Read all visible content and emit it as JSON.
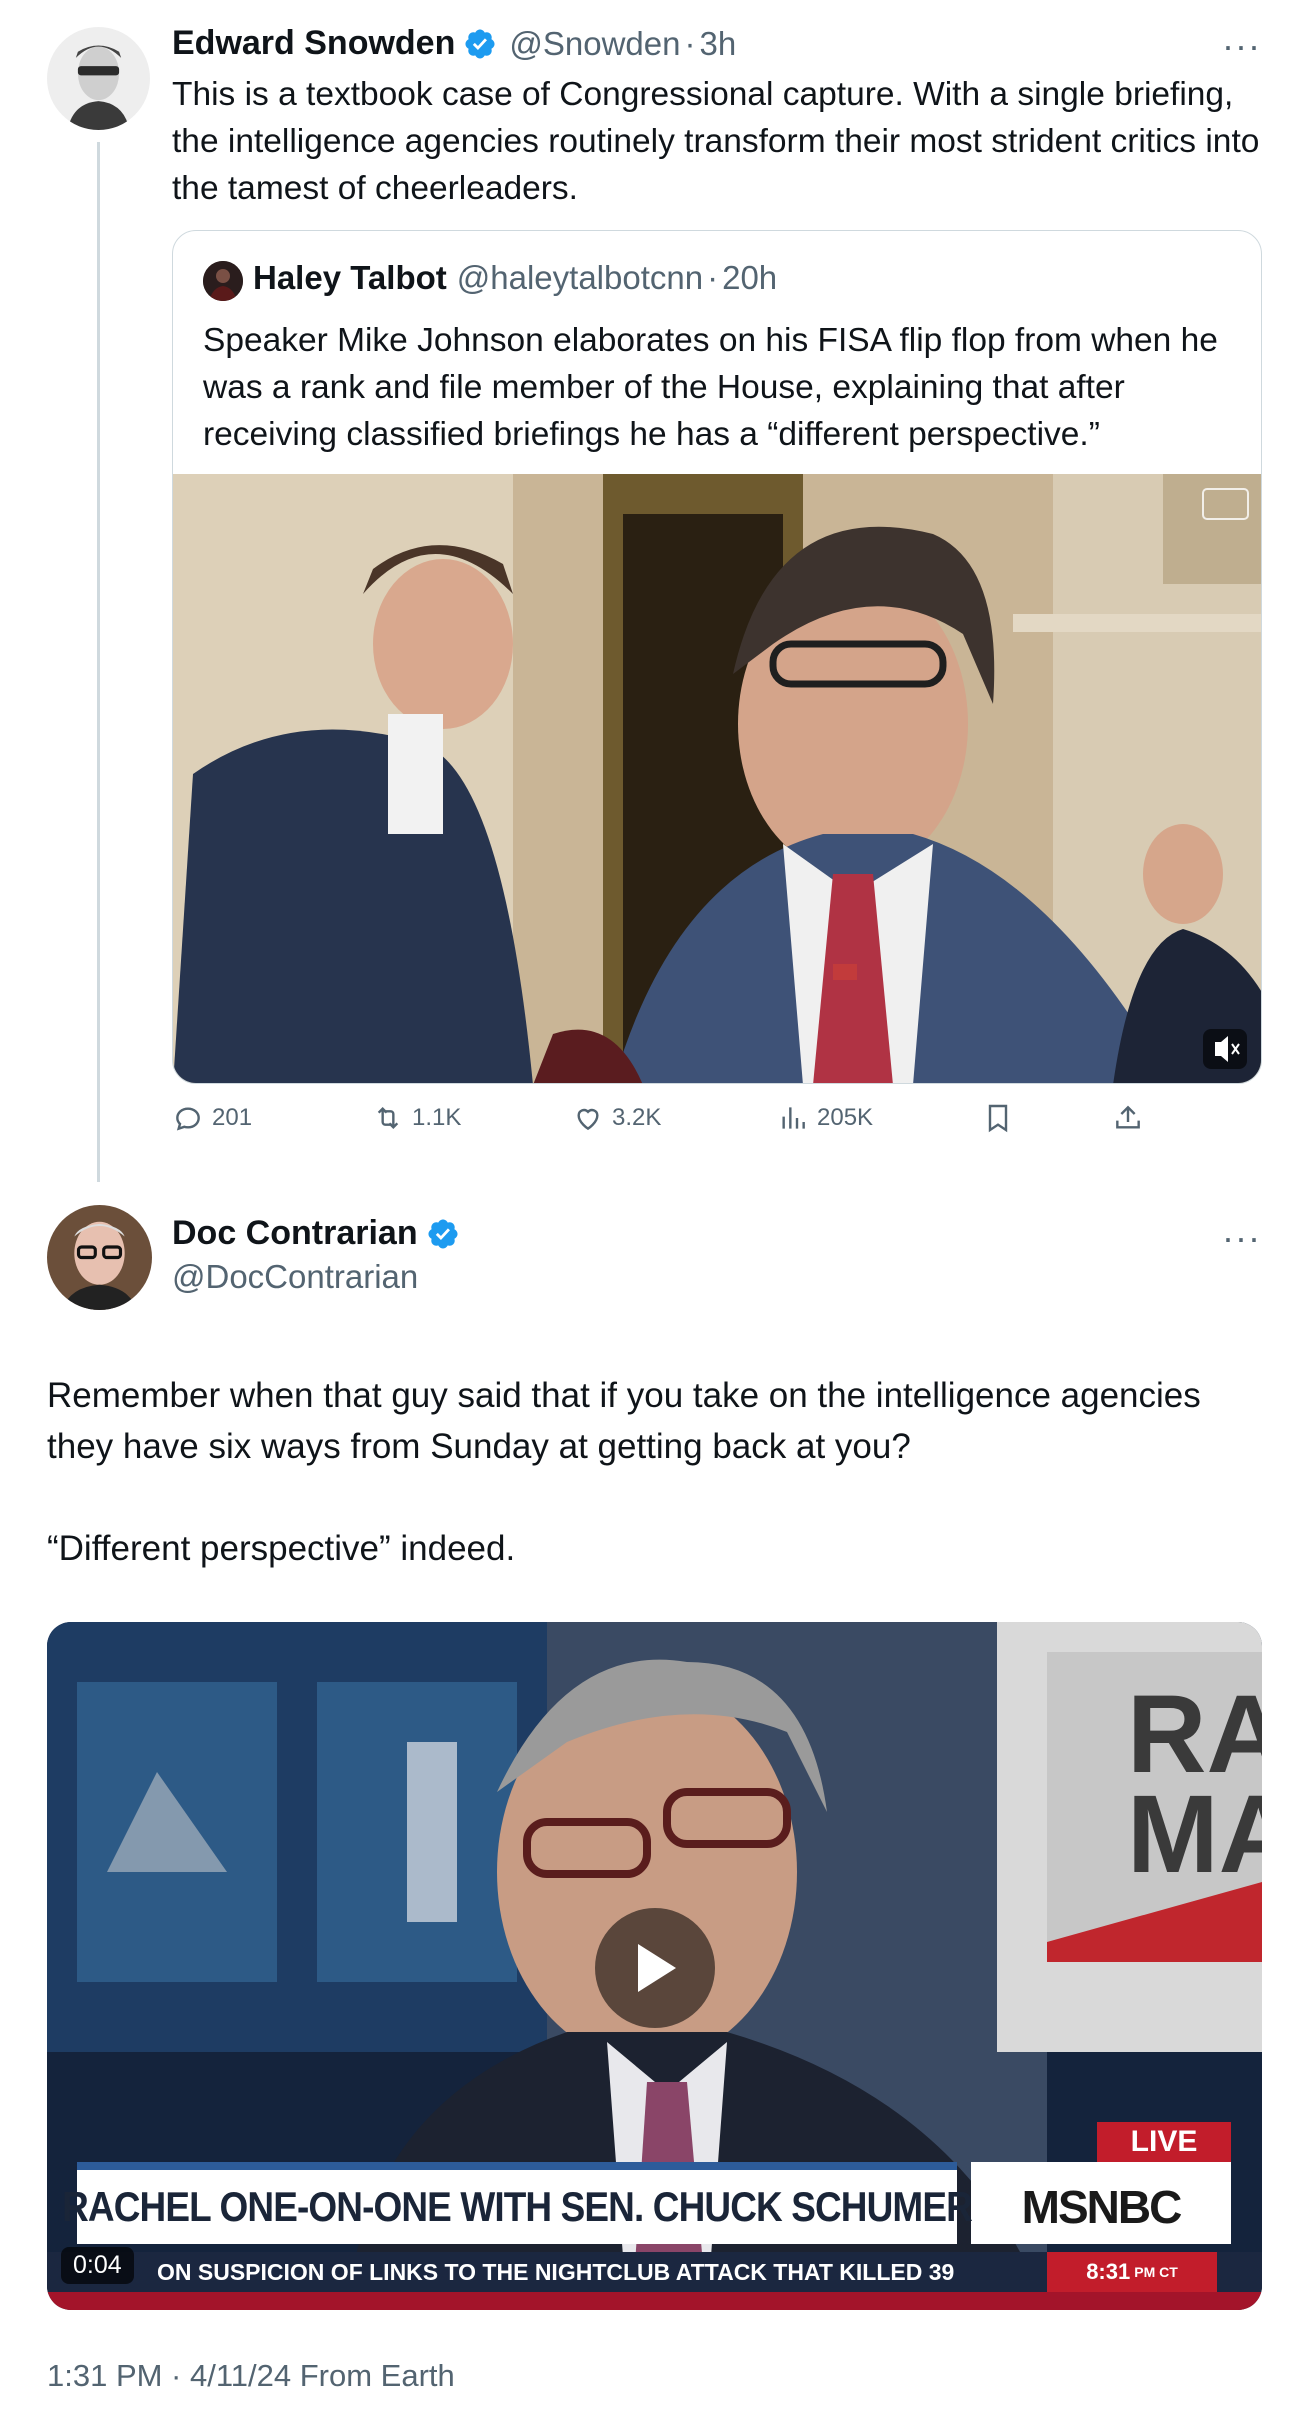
{
  "tweet1": {
    "author_name": "Edward Snowden",
    "handle": "@Snowden",
    "separator": "·",
    "time": "3h",
    "more": "···",
    "text": "This is a textbook case of Congressional capture. With a single briefing, the intelligence agencies routinely transform their most strident critics into the tamest of cheerleaders.",
    "quote": {
      "author_name": "Haley Talbot",
      "handle": "@haleytalbotcnn",
      "separator": "·",
      "time": "20h",
      "text": "Speaker Mike Johnson elaborates on his FISA flip flop from when he was a rank and file member of the House, explaining that after receiving classified briefings he has a “different perspective.”"
    },
    "actions": {
      "replies": "201",
      "reposts": "1.1K",
      "likes": "3.2K",
      "views": "205K"
    }
  },
  "tweet2": {
    "author_name": "Doc Contrarian",
    "handle": "@DocContrarian",
    "more": "···",
    "text_line1": "Remember when that guy said that if you take on the intelligence agencies they have six ways from Sunday at getting back at you?",
    "text_line2": "“Different perspective” indeed.",
    "video": {
      "chyron_main": "RACHEL ONE-ON-ONE WITH SEN. CHUCK SCHUMER",
      "network": "MSNBC",
      "live_label": "LIVE",
      "ticker": "ON SUSPICION OF LINKS TO THE NIGHTCLUB ATTACK THAT KILLED 39",
      "ticker_time": "8:31",
      "ticker_time_suffix": "PM CT",
      "duration": "0:04"
    },
    "footer": "1:31 PM · 4/11/24 From Earth"
  },
  "colors": {
    "verified": "#1d9bf0",
    "secondary_text": "#536471",
    "border": "#cfd9de"
  }
}
